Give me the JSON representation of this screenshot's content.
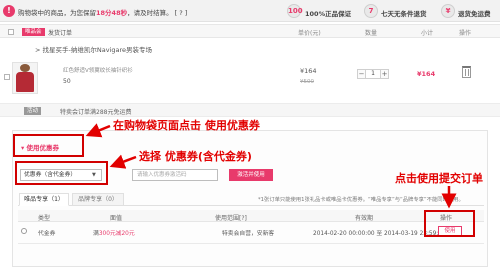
{
  "notice": {
    "icon": "!",
    "text_before": "购物袋中的商品，为您保留",
    "countdown": "18分48秒",
    "text_after": "，请及时结算。 [ ? ]"
  },
  "badges": [
    {
      "icon": "100",
      "icon_name": "authentic-badge-icon",
      "label": "100%正品保证"
    },
    {
      "icon": "7",
      "icon_name": "seven-day-return-icon",
      "label": "七天无条件退货"
    },
    {
      "icon": "¥",
      "icon_name": "shipping-refund-icon",
      "label": "退货免运费"
    }
  ],
  "table_header": {
    "vip_tag": "唯品会",
    "title": "发货订单",
    "columns": [
      "单价(元)",
      "数量",
      "小计",
      "操作"
    ]
  },
  "shop": {
    "name": "> 找星买手-纳维凯尔Navigare男装专场"
  },
  "product": {
    "name": "红色舒适V领翼纹长袖针织衫",
    "size": "50",
    "price": "¥164",
    "original_price": "¥500",
    "quantity": "1",
    "minus": "−",
    "plus": "+",
    "subtotal": "¥164"
  },
  "footer": {
    "tag": "活动",
    "text": "特卖会订单满288元免运费"
  },
  "coupon": {
    "use_link": "▾ 使用优惠券",
    "select_value": "优惠券（含代金券）",
    "chevron": "▼",
    "code_placeholder": "请输入优惠券激活码",
    "add_button": "激活并使用",
    "tabs": [
      {
        "label": "唯品专享（1）",
        "active": true
      },
      {
        "label": "品牌专享（0）",
        "active": false
      }
    ],
    "note": "*1张订单只能使用1张礼品卡或唯品卡优惠券。“唯品专享”与“品牌专享”不能同时使用。",
    "table_headers": [
      "类型",
      "面值",
      "使用范围[?]",
      "有效期",
      "操作"
    ],
    "rows": [
      {
        "type": "代金券",
        "value_prefix": "满",
        "value_condition": "300元减20元",
        "scope": "特卖会自营，安新客",
        "validity": "2014-02-20 00:00:00 至 2014-03-19 23:59:",
        "action": "使用"
      }
    ]
  },
  "annotations": {
    "step1": "在购物袋页面点击 使用优惠券",
    "step2": "选择 优惠券(含代金券)",
    "step3": "点击使用提交订单"
  },
  "colors": {
    "accent": "#e83a6b",
    "annotation": "#e20000"
  }
}
